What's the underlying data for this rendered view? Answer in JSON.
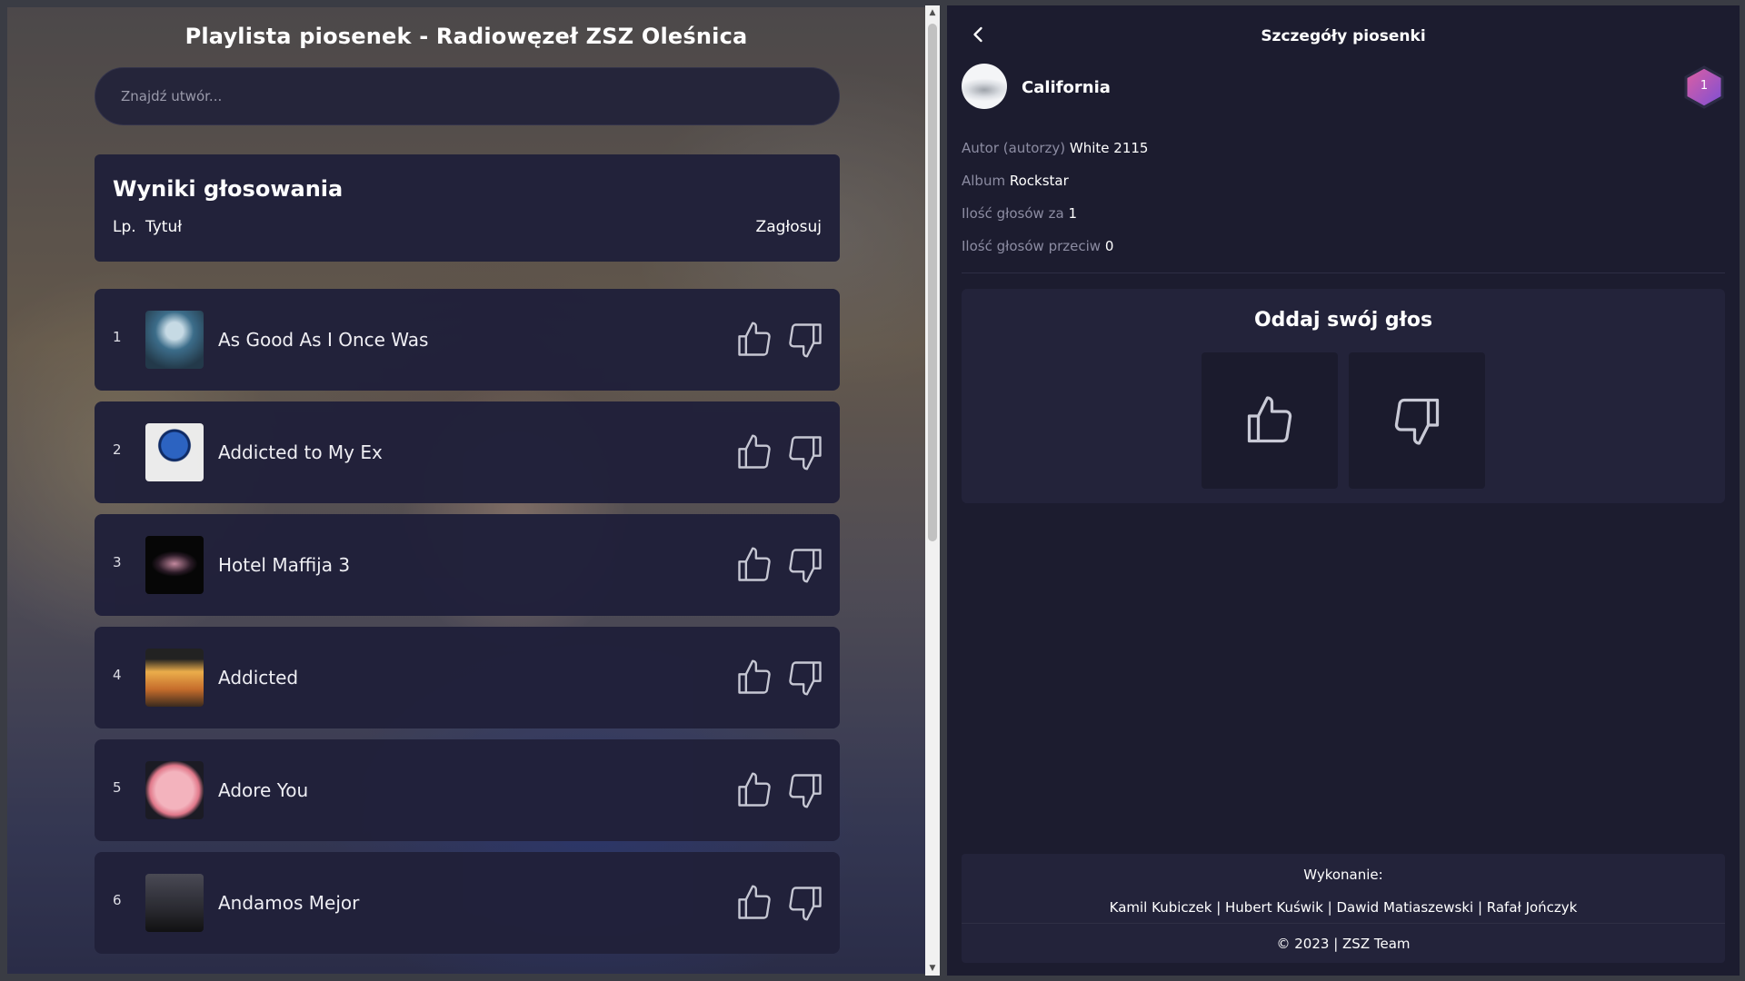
{
  "playlist": {
    "title": "Playlista piosenek - Radiowęzeł ZSZ Oleśnica",
    "search_placeholder": "Znajdź utwór...",
    "results_title": "Wyniki głosowania",
    "col_number": "Lp.",
    "col_title": "Tytuł",
    "col_vote": "Zagłosuj",
    "songs": [
      {
        "number": "1",
        "title": "As Good As I Once Was",
        "cover_icon": "album-cover-icon"
      },
      {
        "number": "2",
        "title": "Addicted to My Ex",
        "cover_icon": "album-cover-icon"
      },
      {
        "number": "3",
        "title": "Hotel Maffija 3",
        "cover_icon": "album-cover-icon"
      },
      {
        "number": "4",
        "title": "Addicted",
        "cover_icon": "album-cover-icon"
      },
      {
        "number": "5",
        "title": "Adore You",
        "cover_icon": "album-cover-icon"
      },
      {
        "number": "6",
        "title": "Andamos Mejor",
        "cover_icon": "album-cover-icon"
      }
    ]
  },
  "details": {
    "header": "Szczegóły piosenki",
    "song_title": "California",
    "rank": "1",
    "author_label": "Autor (autorzy)",
    "author_value": "White 2115",
    "album_label": "Album",
    "album_value": "Rockstar",
    "votes_for_label": "Ilość głosów za",
    "votes_for_value": "1",
    "votes_against_label": "Ilość głosów przeciw",
    "votes_against_value": "0",
    "vote_title": "Oddaj swój głos"
  },
  "footer": {
    "label": "Wykonanie:",
    "authors": "Kamil Kubiczek | Hubert Kuświk | Dawid Matiaszewski | Rafał Jończyk",
    "copyright": "© 2023 | ZSZ Team"
  },
  "colors": {
    "panel": "#21213a",
    "right_background": "#1c1c2f",
    "badge_gradient_start": "#e05fa0",
    "badge_gradient_end": "#7a4fd6"
  }
}
